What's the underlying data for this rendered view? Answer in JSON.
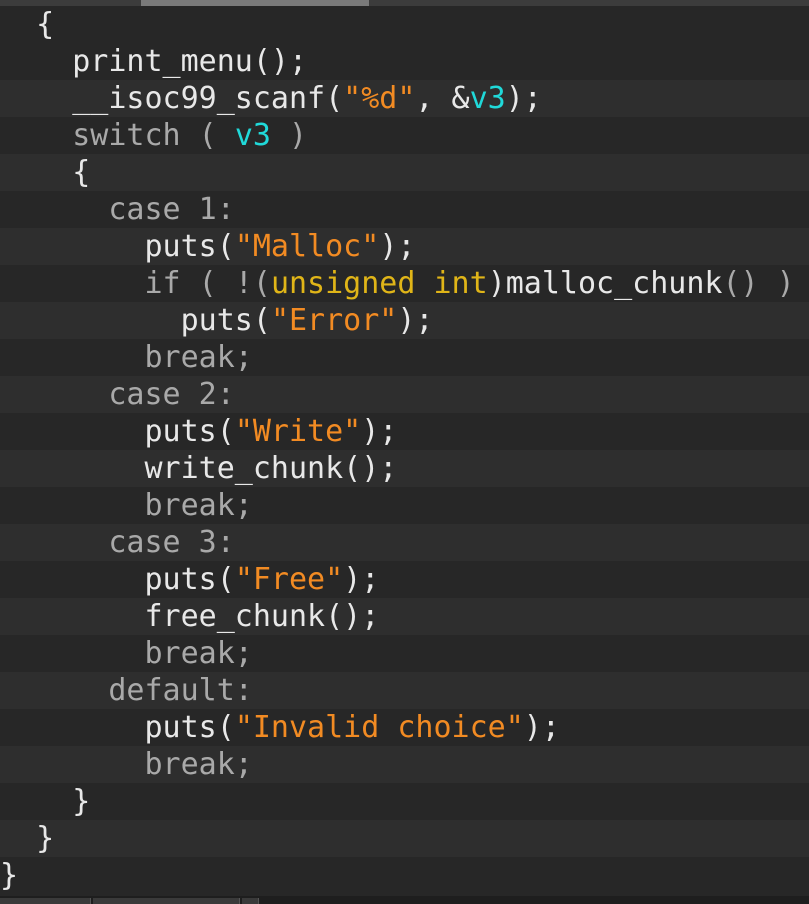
{
  "colors": {
    "background": "#272727",
    "keyword": "#a9a9a9",
    "plain": "#e8e8e8",
    "string": "#f28b23",
    "variable": "#20d9d9",
    "type": "#e0b518"
  },
  "lines": [
    [
      {
        "t": "  ",
        "c": "pl"
      },
      {
        "t": "{",
        "c": "pn"
      }
    ],
    [
      {
        "t": "    print_menu",
        "c": "pl"
      },
      {
        "t": "();",
        "c": "pn"
      }
    ],
    [
      {
        "t": "    __isoc99_scanf",
        "c": "pl"
      },
      {
        "t": "(",
        "c": "pn"
      },
      {
        "t": "\"%d\"",
        "c": "str"
      },
      {
        "t": ", &",
        "c": "pn"
      },
      {
        "t": "v3",
        "c": "var"
      },
      {
        "t": ");",
        "c": "pn"
      }
    ],
    [
      {
        "t": "    switch",
        "c": "kw"
      },
      {
        "t": " ( ",
        "c": "kw"
      },
      {
        "t": "v3",
        "c": "var"
      },
      {
        "t": " )",
        "c": "kw"
      }
    ],
    [
      {
        "t": "    {",
        "c": "pn"
      }
    ],
    [
      {
        "t": "      case 1:",
        "c": "kw"
      }
    ],
    [
      {
        "t": "        puts",
        "c": "pl"
      },
      {
        "t": "(",
        "c": "pn"
      },
      {
        "t": "\"Malloc\"",
        "c": "str"
      },
      {
        "t": ");",
        "c": "pn"
      }
    ],
    [
      {
        "t": "        if ( !(",
        "c": "kw"
      },
      {
        "t": "unsigned int",
        "c": "typ"
      },
      {
        "t": ")",
        "c": "pn"
      },
      {
        "t": "malloc_chunk",
        "c": "pl"
      },
      {
        "t": "() )",
        "c": "kw"
      }
    ],
    [
      {
        "t": "          puts",
        "c": "pl"
      },
      {
        "t": "(",
        "c": "pn"
      },
      {
        "t": "\"Error\"",
        "c": "str"
      },
      {
        "t": ");",
        "c": "pn"
      }
    ],
    [
      {
        "t": "        break;",
        "c": "kw"
      }
    ],
    [
      {
        "t": "      case 2:",
        "c": "kw"
      }
    ],
    [
      {
        "t": "        puts",
        "c": "pl"
      },
      {
        "t": "(",
        "c": "pn"
      },
      {
        "t": "\"Write\"",
        "c": "str"
      },
      {
        "t": ");",
        "c": "pn"
      }
    ],
    [
      {
        "t": "        write_chunk",
        "c": "pl"
      },
      {
        "t": "();",
        "c": "pn"
      }
    ],
    [
      {
        "t": "        break;",
        "c": "kw"
      }
    ],
    [
      {
        "t": "      case 3:",
        "c": "kw"
      }
    ],
    [
      {
        "t": "        puts",
        "c": "pl"
      },
      {
        "t": "(",
        "c": "pn"
      },
      {
        "t": "\"Free\"",
        "c": "str"
      },
      {
        "t": ");",
        "c": "pn"
      }
    ],
    [
      {
        "t": "        free_chunk",
        "c": "pl"
      },
      {
        "t": "();",
        "c": "pn"
      }
    ],
    [
      {
        "t": "        break;",
        "c": "kw"
      }
    ],
    [
      {
        "t": "      default:",
        "c": "kw"
      }
    ],
    [
      {
        "t": "        puts",
        "c": "pl"
      },
      {
        "t": "(",
        "c": "pn"
      },
      {
        "t": "\"Invalid choice\"",
        "c": "str"
      },
      {
        "t": ");",
        "c": "pn"
      }
    ],
    [
      {
        "t": "        break;",
        "c": "kw"
      }
    ],
    [
      {
        "t": "    }",
        "c": "pn"
      }
    ],
    [
      {
        "t": "  }",
        "c": "pn"
      }
    ],
    [
      {
        "t": "}",
        "c": "pn"
      }
    ]
  ]
}
